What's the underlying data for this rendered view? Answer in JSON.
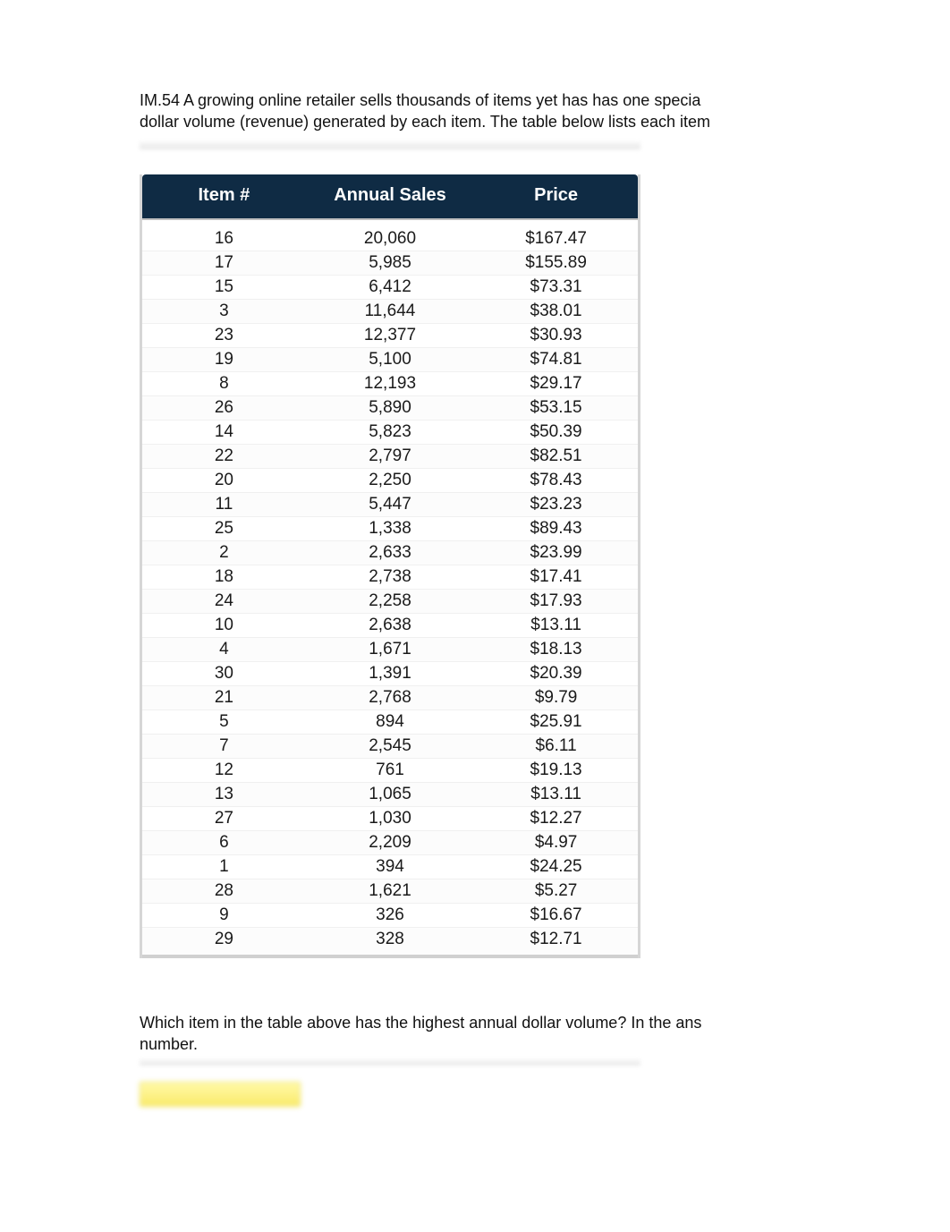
{
  "intro": {
    "line1": "IM.54 A growing online retailer sells thousands of items yet has has  one specia",
    "line2": "dollar volume (revenue) generated by each item. The table below lists each item"
  },
  "table": {
    "headers": {
      "item": "Item #",
      "sales": "Annual Sales",
      "price": "Price"
    },
    "rows": [
      {
        "item": "16",
        "sales": "20,060",
        "price": "$167.47"
      },
      {
        "item": "17",
        "sales": "5,985",
        "price": "$155.89"
      },
      {
        "item": "15",
        "sales": "6,412",
        "price": "$73.31"
      },
      {
        "item": "3",
        "sales": "11,644",
        "price": "$38.01"
      },
      {
        "item": "23",
        "sales": "12,377",
        "price": "$30.93"
      },
      {
        "item": "19",
        "sales": "5,100",
        "price": "$74.81"
      },
      {
        "item": "8",
        "sales": "12,193",
        "price": "$29.17"
      },
      {
        "item": "26",
        "sales": "5,890",
        "price": "$53.15"
      },
      {
        "item": "14",
        "sales": "5,823",
        "price": "$50.39"
      },
      {
        "item": "22",
        "sales": "2,797",
        "price": "$82.51"
      },
      {
        "item": "20",
        "sales": "2,250",
        "price": "$78.43"
      },
      {
        "item": "11",
        "sales": "5,447",
        "price": "$23.23"
      },
      {
        "item": "25",
        "sales": "1,338",
        "price": "$89.43"
      },
      {
        "item": "2",
        "sales": "2,633",
        "price": "$23.99"
      },
      {
        "item": "18",
        "sales": "2,738",
        "price": "$17.41"
      },
      {
        "item": "24",
        "sales": "2,258",
        "price": "$17.93"
      },
      {
        "item": "10",
        "sales": "2,638",
        "price": "$13.11"
      },
      {
        "item": "4",
        "sales": "1,671",
        "price": "$18.13"
      },
      {
        "item": "30",
        "sales": "1,391",
        "price": "$20.39"
      },
      {
        "item": "21",
        "sales": "2,768",
        "price": "$9.79"
      },
      {
        "item": "5",
        "sales": "894",
        "price": "$25.91"
      },
      {
        "item": "7",
        "sales": "2,545",
        "price": "$6.11"
      },
      {
        "item": "12",
        "sales": "761",
        "price": "$19.13"
      },
      {
        "item": "13",
        "sales": "1,065",
        "price": "$13.11"
      },
      {
        "item": "27",
        "sales": "1,030",
        "price": "$12.27"
      },
      {
        "item": "6",
        "sales": "2,209",
        "price": "$4.97"
      },
      {
        "item": "1",
        "sales": "394",
        "price": "$24.25"
      },
      {
        "item": "28",
        "sales": "1,621",
        "price": "$5.27"
      },
      {
        "item": "9",
        "sales": "326",
        "price": "$16.67"
      },
      {
        "item": "29",
        "sales": "328",
        "price": "$12.71"
      }
    ]
  },
  "question": {
    "line1": "Which item in the table above has the highest annual dollar volume?  In the ans",
    "line2": "number."
  }
}
